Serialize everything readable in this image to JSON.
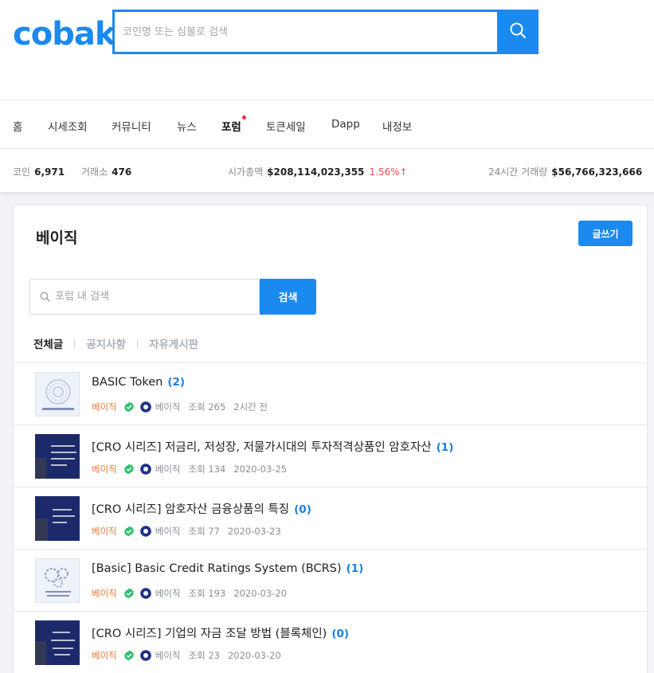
{
  "header": {
    "logo": "cobak",
    "search_placeholder": "코인명 또는 심볼로 검색"
  },
  "nav": {
    "items": [
      "홈",
      "시세조회",
      "커뮤니티",
      "뉴스",
      "포럼",
      "토큰세일",
      "Dapp",
      "내정보"
    ],
    "active": "포럼"
  },
  "stats": {
    "coin_label": "코인",
    "coin_value": "6,971",
    "exchange_label": "거래소",
    "exchange_value": "476",
    "marketcap_label": "시가총액",
    "marketcap_value": "$208,114,023,355",
    "marketcap_change": "1.56%↑",
    "volume_label": "24시간 거래량",
    "volume_value": "$56,766,323,666"
  },
  "forum": {
    "title": "베이직",
    "write_label": "글쓰기",
    "search_placeholder": "포럼 내 검색",
    "search_button": "검색",
    "tabs": [
      "전체글",
      "공지사항",
      "자유게시판"
    ]
  },
  "posts": [
    {
      "title": "BASIC Token",
      "comments": "(2)",
      "board": "베이직",
      "author": "베이직",
      "views": "조회 265",
      "date": "2시간 전",
      "thumb": "light-logo"
    },
    {
      "title": "[CRO 시리즈] 저금리, 저성장, 저물가시대의 투자적격상품인 암호자산",
      "comments": "(1)",
      "board": "베이직",
      "author": "베이직",
      "views": "조회 134",
      "date": "2020-03-25",
      "thumb": "dark"
    },
    {
      "title": "[CRO 시리즈] 암호자산 금융상품의 특징",
      "comments": "(0)",
      "board": "베이직",
      "author": "베이직",
      "views": "조회 77",
      "date": "2020-03-23",
      "thumb": "dark"
    },
    {
      "title": "[Basic] Basic Credit Ratings System (BCRS)",
      "comments": "(1)",
      "board": "베이직",
      "author": "베이직",
      "views": "조회 193",
      "date": "2020-03-20",
      "thumb": "light-gears"
    },
    {
      "title": "[CRO 시리즈] 기업의 자금 조달 방법 (블록체인)",
      "comments": "(0)",
      "board": "베이직",
      "author": "베이직",
      "views": "조회 23",
      "date": "2020-03-20",
      "thumb": "dark"
    }
  ],
  "colors": {
    "brand": "#1a8af0",
    "board": "#e07b3c",
    "up": "#ef5350",
    "verified": "#2fbf71"
  }
}
